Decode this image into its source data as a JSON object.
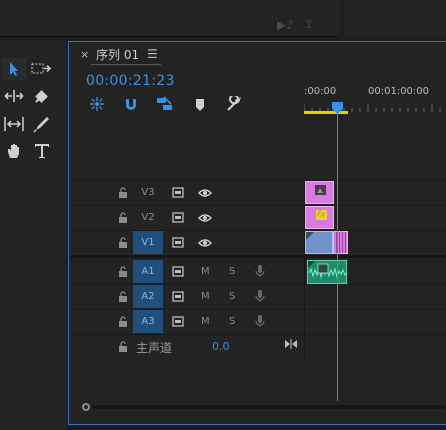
{
  "panel": {
    "tab_title": "序列 01",
    "close_glyph": "×",
    "menu_glyph": "☰",
    "timecode": "00:00:21:23"
  },
  "ruler": {
    "labels": [
      ":00:00",
      "00:01:00:00"
    ]
  },
  "tracks": {
    "video": [
      {
        "label": "V3",
        "selected": false
      },
      {
        "label": "V2",
        "selected": false
      },
      {
        "label": "V1",
        "selected": true
      }
    ],
    "audio": [
      {
        "label": "A1",
        "selected": true,
        "m": "M",
        "s": "S"
      },
      {
        "label": "A2",
        "selected": true,
        "m": "M",
        "s": "S"
      },
      {
        "label": "A3",
        "selected": true,
        "m": "M",
        "s": "S"
      }
    ],
    "master": {
      "name": "主声道",
      "value": "0.0"
    }
  },
  "clips": {
    "v2_fx_badge": "fx"
  },
  "tools": [
    "selection-tool",
    "track-select-forward-tool",
    "ripple-edit-tool",
    "razor-tool",
    "slip-tool",
    "pen-tool",
    "hand-tool",
    "type-tool"
  ],
  "colors": {
    "accent": "#3b8fe4",
    "track_selected": "#1f4f7a",
    "clip_pink": "#d77be0",
    "clip_blue": "#6f93c9",
    "clip_green": "#1f8a6c",
    "work_area": "#e6d200"
  }
}
